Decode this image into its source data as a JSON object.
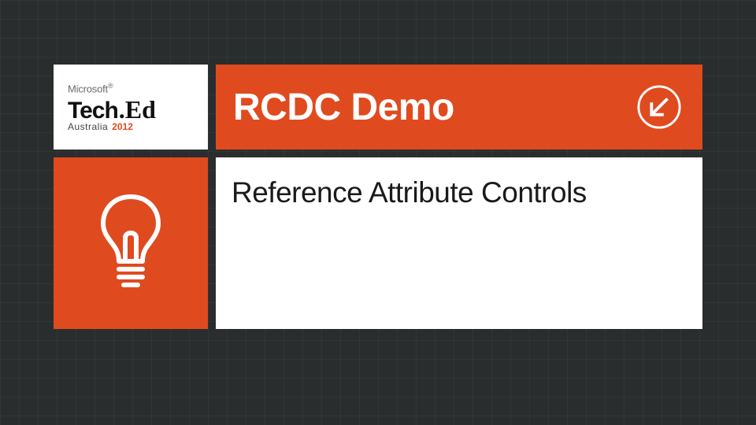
{
  "logo": {
    "vendor": "Microsoft",
    "vendor_mark": "®",
    "brand_left": "Tech",
    "brand_right": ".Ed",
    "region": "Australia",
    "year": "2012"
  },
  "title": "RCDC Demo",
  "subtitle": "Reference Attribute Controls",
  "colors": {
    "accent": "#e04a1f",
    "bg": "#2a2d2e"
  }
}
